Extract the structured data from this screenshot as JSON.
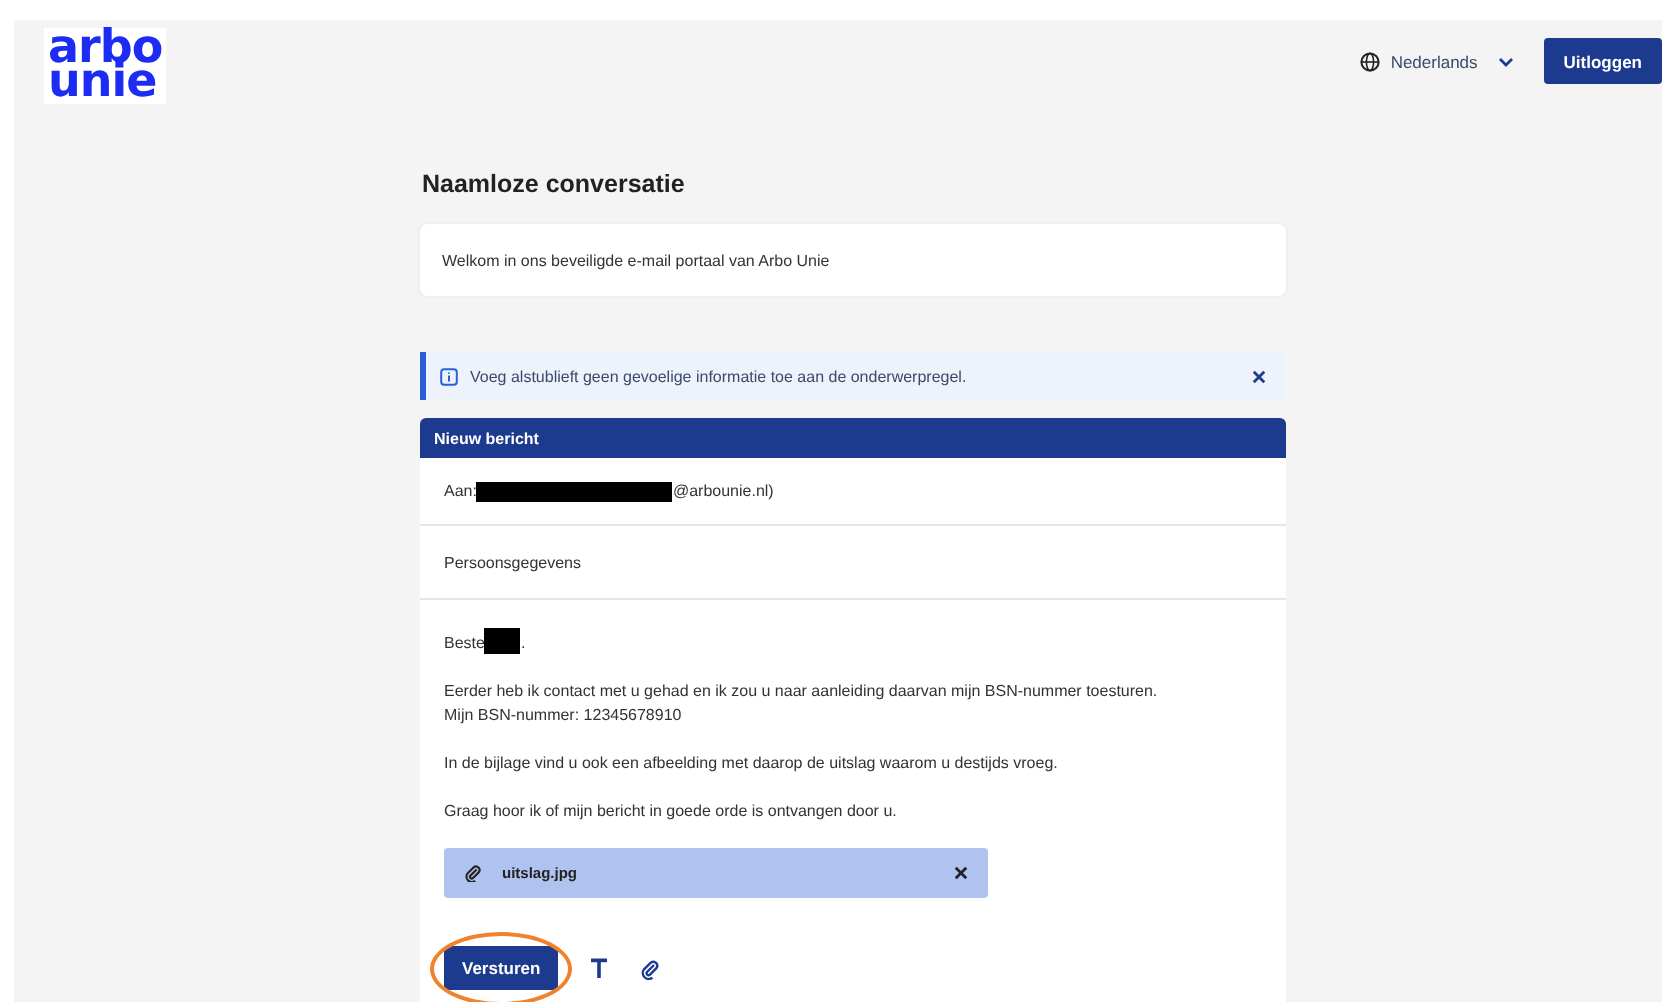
{
  "logo": {
    "lines": [
      "arbo",
      "unie"
    ]
  },
  "header": {
    "language": "Nederlands",
    "logout_button": "Uitloggen"
  },
  "title": "Naamloze conversatie",
  "welcome": "Welkom in ons beveiligde e-mail portaal van Arbo Unie",
  "alert": {
    "text": "Voeg alstublieft geen gevoelige informatie toe aan de onderwerpregel."
  },
  "message": {
    "header": "Nieuw bericht",
    "to_label": "Aan:",
    "to_suffix": "@arbounie.nl)",
    "subject": "Persoonsgegevens",
    "greeting": "Beste",
    "greeting_end": ".",
    "paragraphs": [
      [
        "Eerder heb ik contact met u gehad en ik zou u naar aanleiding daarvan mijn BSN-nummer toesturen.",
        "Mijn BSN-nummer: 12345678910"
      ],
      [
        "In de bijlage vind u ook een afbeelding met daarop de uitslag waarom u destijds vroeg."
      ],
      [
        "Graag hoor ik of mijn bericht in goede orde is ontvangen door u."
      ]
    ],
    "attachments": [
      {
        "name": "uitslag.jpg"
      }
    ],
    "send_button": "Versturen",
    "send_highlighted": true
  }
}
